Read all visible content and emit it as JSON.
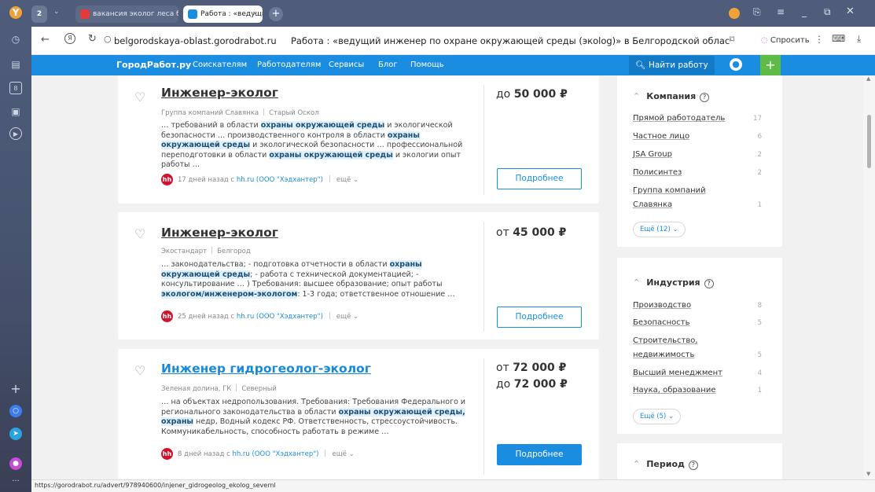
{
  "browser": {
    "tab_count": "2",
    "tabs": [
      {
        "label": "вакансия эколог леса бе",
        "active": false
      },
      {
        "label": "Работа : «ведущий инж",
        "active": true
      }
    ],
    "url": "belgorodskaya-oblast.gorodrabot.ru",
    "page_title": "Работа : «ведущий инженер по охране окружающей среды (экolog)» в Белгородской области —…",
    "ask_label": "Спросить",
    "status_url": "https://gorodrabot.ru/advert/978940600/injener_gidrogeolog_ekolog_severnl"
  },
  "site": {
    "logo": "ГородРабот.ру",
    "nav": [
      "Соискателям",
      "Работодателям",
      "Сервисы",
      "Блог",
      "Помощь"
    ],
    "find_button": "Найти работу",
    "plus": "+"
  },
  "jobs": [
    {
      "title": "Инженер-эколог",
      "company": "Группа компаний Славянка",
      "city": "Старый Оскол",
      "salary_prefix": "до",
      "salary_amount": "50 000 ₽",
      "salary2_prefix": "",
      "salary2_amount": "",
      "snippet": [
        {
          "t": "… требований в области "
        },
        {
          "t": "охраны окружающей среды",
          "h": true
        },
        {
          "t": " и экологической безопасности … производственного контроля в области "
        },
        {
          "t": "охраны окружающей среды",
          "h": true
        },
        {
          "t": " и экологической безопасности … профессиональной переподготовки в области "
        },
        {
          "t": "охраны окружающей среды",
          "h": true
        },
        {
          "t": " и экологии опыт работы …"
        }
      ],
      "age": "17 дней назад с",
      "source": "hh.ru (ООО \"Хэдхантер\")",
      "more": "ещё",
      "button": "Подробнее",
      "primary": false
    },
    {
      "title": "Инженер-эколог",
      "company": "Экостандарт",
      "city": "Белгород",
      "salary_prefix": "от",
      "salary_amount": "45 000 ₽",
      "salary2_prefix": "",
      "salary2_amount": "",
      "snippet": [
        {
          "t": "… законодательства; - подготовка отчетности в области "
        },
        {
          "t": "охраны окружающей среды",
          "h": true
        },
        {
          "t": "; - работа с технической документацией; - консультирование … ) Требования: высшее образование; опыт работы "
        },
        {
          "t": "экологом/инженером-экологом",
          "h": true
        },
        {
          "t": ": 1-3 года; ответственное отношение …"
        }
      ],
      "age": "25 дней назад с",
      "source": "hh.ru (ООО \"Хэдхантер\")",
      "more": "ещё",
      "button": "Подробнее",
      "primary": false
    },
    {
      "title": "Инженер гидрогеолог-эколог",
      "company": "Зеленая долина, ГК",
      "city": "Северный",
      "salary_prefix": "от",
      "salary_amount": "72 000 ₽",
      "salary2_prefix": "до",
      "salary2_amount": "72 000 ₽",
      "snippet": [
        {
          "t": "… на объектах недропользования. Требования: Требования Федерального и регионального законодательства в области "
        },
        {
          "t": "охраны окружающей среды, охраны",
          "h": true
        },
        {
          "t": " недр, Водный кодекс РФ. Ответственность, стрессоустойчивость. Коммуникабельность, способность работать в режиме …"
        }
      ],
      "age": "8 дней назад с",
      "source": "hh.ru (ООО \"Хэдхантер\")",
      "more": "ещё",
      "button": "Подробнее",
      "primary": true
    }
  ],
  "filters": {
    "company": {
      "title": "Компания",
      "items": [
        {
          "label": "Прямой работодатель",
          "count": "17"
        },
        {
          "label": "Частное лицо",
          "count": "6"
        },
        {
          "label": "JSA Group",
          "count": "2"
        },
        {
          "label": "Полисинтез",
          "count": "2"
        },
        {
          "label": "Группа компаний Славянка",
          "count": "1"
        }
      ],
      "more": "Ещё (12)"
    },
    "industry": {
      "title": "Индустрия",
      "items": [
        {
          "label": "Производство",
          "count": "8"
        },
        {
          "label": "Безопасность",
          "count": "5"
        },
        {
          "label": "Строительство, недвижимость",
          "count": "5"
        },
        {
          "label": "Высший менеджмент",
          "count": "4"
        },
        {
          "label": "Наука, образование",
          "count": "1"
        }
      ],
      "more": "Ещё (5)"
    },
    "period": {
      "title": "Период"
    }
  }
}
